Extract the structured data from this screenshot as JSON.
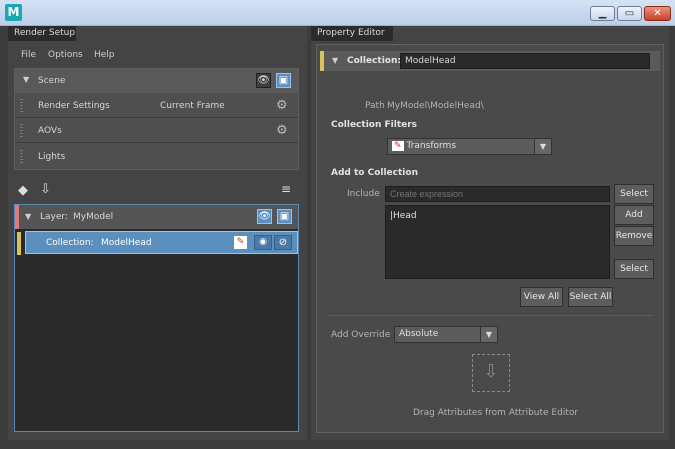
{
  "window": {
    "logo": "M",
    "controls": [
      "minimize-icon",
      "maximize-icon",
      "close-icon"
    ]
  },
  "left": {
    "tab": "Render Setup",
    "menu": [
      "File",
      "Options",
      "Help"
    ],
    "scene": {
      "label": "Scene",
      "rows": [
        {
          "label": "Render Settings",
          "value": "Current Frame"
        },
        {
          "label": "AOVs",
          "value": ""
        },
        {
          "label": "Lights",
          "value": ""
        }
      ]
    },
    "layer": {
      "prefix": "Layer:",
      "name": "MyModel",
      "accent": "#e07b7b"
    },
    "collection": {
      "prefix": "Collection:",
      "name": "ModelHead",
      "accent": "#d8c35a"
    }
  },
  "right": {
    "tab": "Property Editor",
    "collection_label": "Collection:",
    "collection_name": "ModelHead",
    "path_label": "Path",
    "path_value": "MyModel\\ModelHead\\",
    "filters_title": "Collection Filters",
    "filter_value": "Transforms",
    "add_title": "Add to Collection",
    "include_label": "Include",
    "include_placeholder": "Create expression",
    "list_items": [
      "|Head"
    ],
    "buttons": {
      "select1": "Select",
      "add": "Add",
      "remove": "Remove",
      "select2": "Select",
      "view_all": "View All",
      "select_all": "Select All"
    },
    "override_label": "Add Override",
    "override_value": "Absolute",
    "drag_text": "Drag Attributes from Attribute Editor"
  }
}
